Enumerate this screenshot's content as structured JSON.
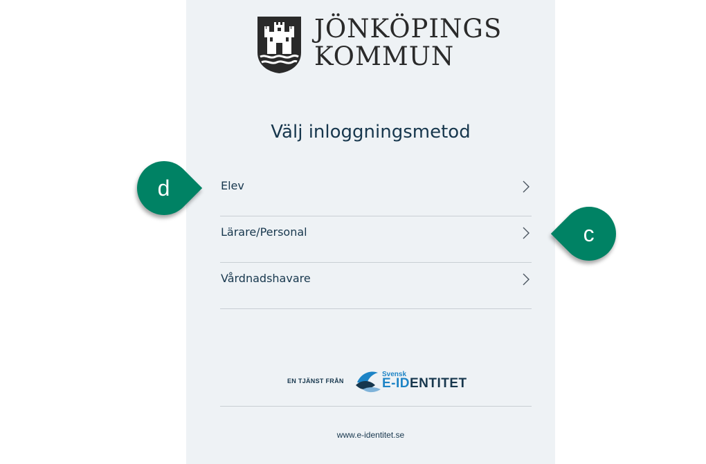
{
  "logo": {
    "line1": "JÖNKÖPINGS",
    "line2": "KOMMUN",
    "crest_icon": "castle-crest-icon"
  },
  "page_title": "Välj inloggningsmetod",
  "menu": {
    "items": [
      {
        "label": "Elev",
        "icon": "chevron-right-icon"
      },
      {
        "label": "Lärare/Personal",
        "icon": "chevron-right-icon"
      },
      {
        "label": "Vårdnadshavare",
        "icon": "chevron-right-icon"
      }
    ]
  },
  "callouts": {
    "d": "d",
    "c": "c"
  },
  "footer": {
    "tagline": "EN TJÄNST FRÅN",
    "brand_small": "Svensk",
    "brand_prefix": "E-ID",
    "brand_suffix": "ENTITET",
    "link": "www.e-identitet.se"
  },
  "colors": {
    "panel_bg": "#eef2f5",
    "text_primary": "#17374d",
    "divider": "#c8ced3",
    "callout": "#008264",
    "brand_blue": "#1d84c6"
  }
}
